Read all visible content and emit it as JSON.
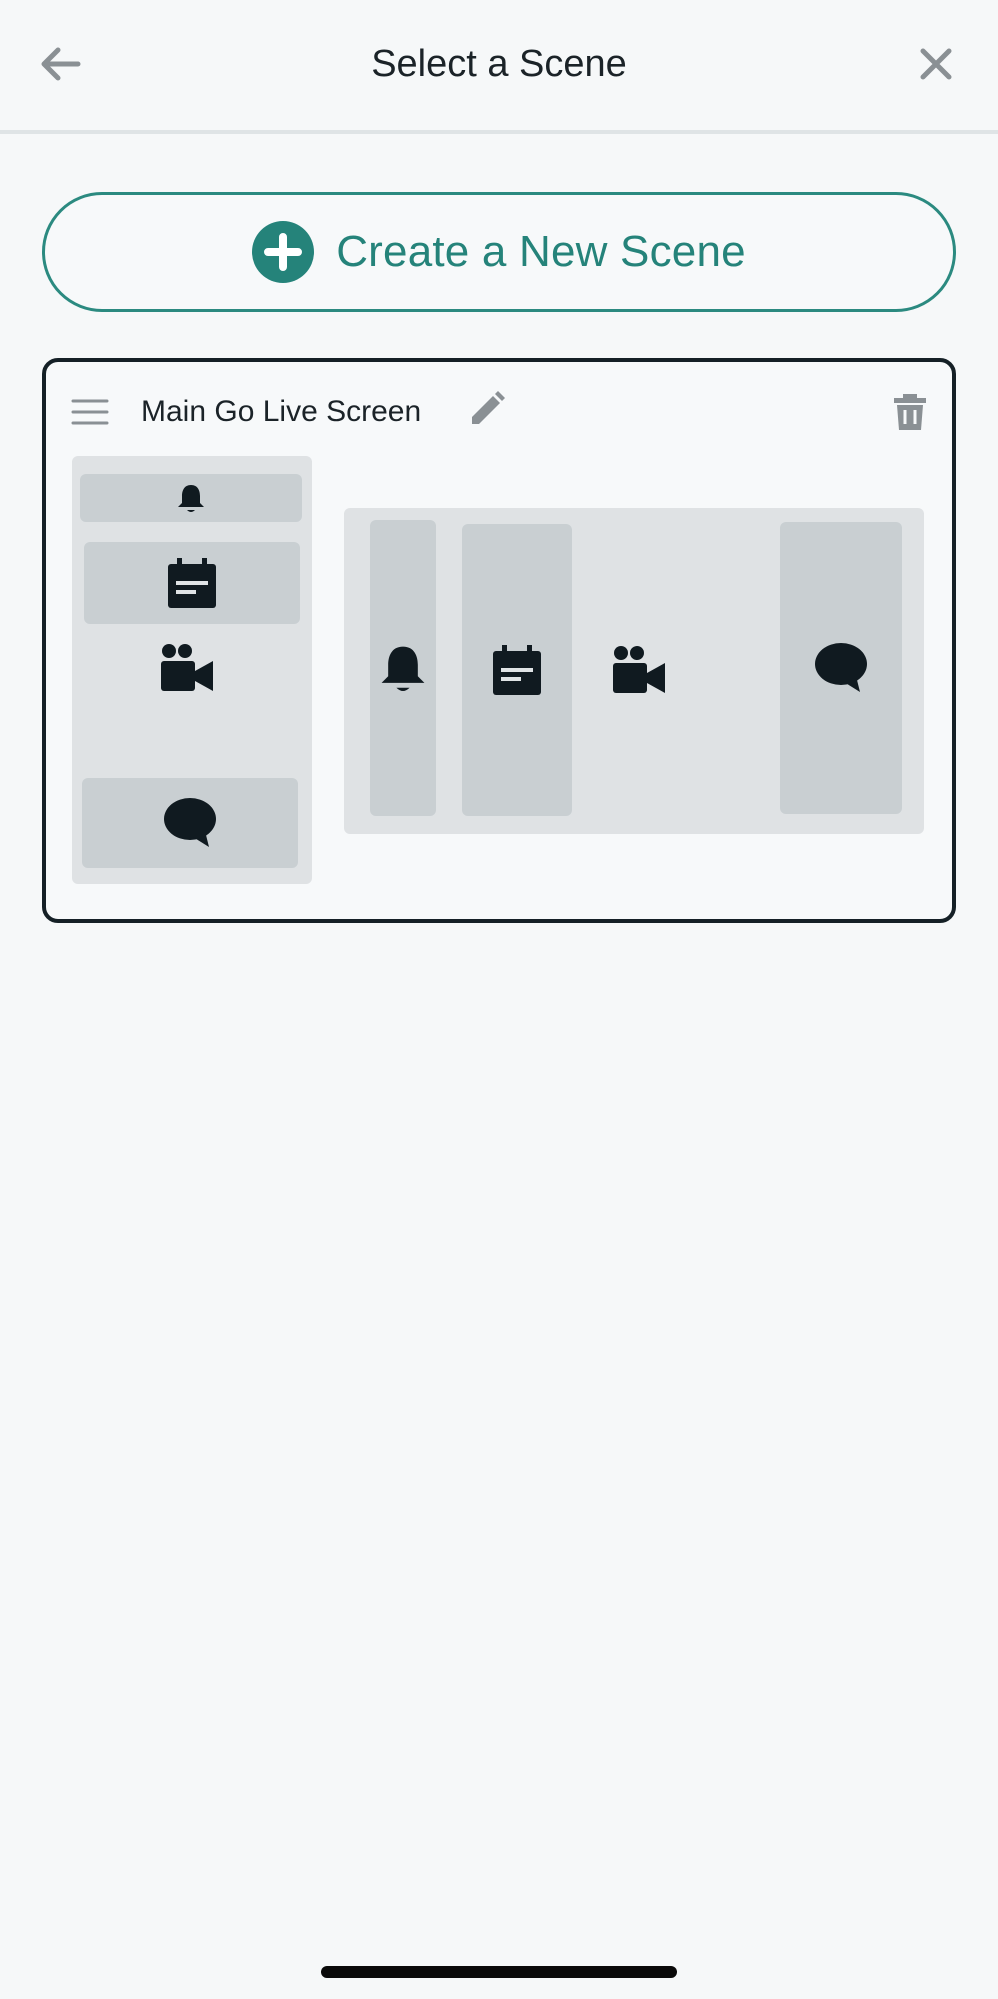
{
  "header": {
    "title": "Select a Scene",
    "back_icon": "arrow-left-icon",
    "close_icon": "close-icon"
  },
  "create_button": {
    "label": "Create a New Scene",
    "icon": "plus-circle-icon",
    "accent_color": "#25837a"
  },
  "scene_card": {
    "name": "Main Go Live Screen",
    "icons": [
      "drag-handle-icon",
      "pencil-icon",
      "trash-icon"
    ],
    "portrait_preview": {
      "widgets": [
        "bell-icon",
        "calendar-note-icon",
        "video-camera-icon",
        "chat-bubble-icon"
      ]
    },
    "landscape_preview": {
      "widgets": [
        "bell-icon",
        "calendar-note-icon",
        "video-camera-icon",
        "chat-bubble-icon"
      ]
    },
    "border_color": "#152026"
  }
}
